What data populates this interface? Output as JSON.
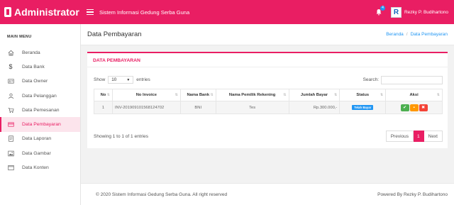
{
  "brand": {
    "name": "Administrator"
  },
  "topbar": {
    "app_title": "Sistem Informasi Gedung Serba Guna",
    "notification_count": "4",
    "avatar_letter": "R",
    "user_name": "Rezky P. Budihartono"
  },
  "sidebar": {
    "menu_title": "MAIN MENU",
    "items": [
      {
        "label": "Beranda",
        "icon": "home-icon"
      },
      {
        "label": "Data Bank",
        "icon": "dollar-icon"
      },
      {
        "label": "Data Owner",
        "icon": "id-card-icon"
      },
      {
        "label": "Data Pelanggan",
        "icon": "user-icon"
      },
      {
        "label": "Data Pemesanan",
        "icon": "cart-icon"
      },
      {
        "label": "Data Pembayaran",
        "icon": "credit-card-icon",
        "active": true
      },
      {
        "label": "Data Laporan",
        "icon": "report-icon"
      },
      {
        "label": "Data Gambar",
        "icon": "image-icon"
      },
      {
        "label": "Data Konten",
        "icon": "window-icon"
      }
    ]
  },
  "page": {
    "title": "Data Pembayaran",
    "breadcrumb": {
      "home": "Beranda",
      "current": "Data Pembayaran"
    }
  },
  "card": {
    "title": "DATA PEMBAYARAN",
    "show_label": "Show",
    "entries_value": "10",
    "entries_label": "entries",
    "search_label": "Search:",
    "search_value": ""
  },
  "table": {
    "columns": [
      "No",
      "No Invoice",
      "Nama Bank",
      "Nama Pemilik Rekening",
      "Jumlah Bayar",
      "Status",
      "Aksi"
    ],
    "rows": [
      {
        "no": "1",
        "invoice": "INV-20190910156812470​2",
        "bank": "BNI",
        "owner": "Tes",
        "amount": "Rp.300.000,-",
        "status": "Telah Bayar"
      }
    ]
  },
  "pagination": {
    "info": "Showing 1 to 1 of 1 entries",
    "previous": "Previous",
    "current": "1",
    "next": "Next"
  },
  "footer": {
    "left": "© 2020 Sistem Informasi Gedung Serba Guna. All right reserved",
    "right": "Powered By Rezky P. Budihartono"
  },
  "colors": {
    "accent": "#e91e63",
    "info": "#2196f3",
    "success": "#4caf50",
    "warning": "#ff9800",
    "danger": "#f44336"
  }
}
